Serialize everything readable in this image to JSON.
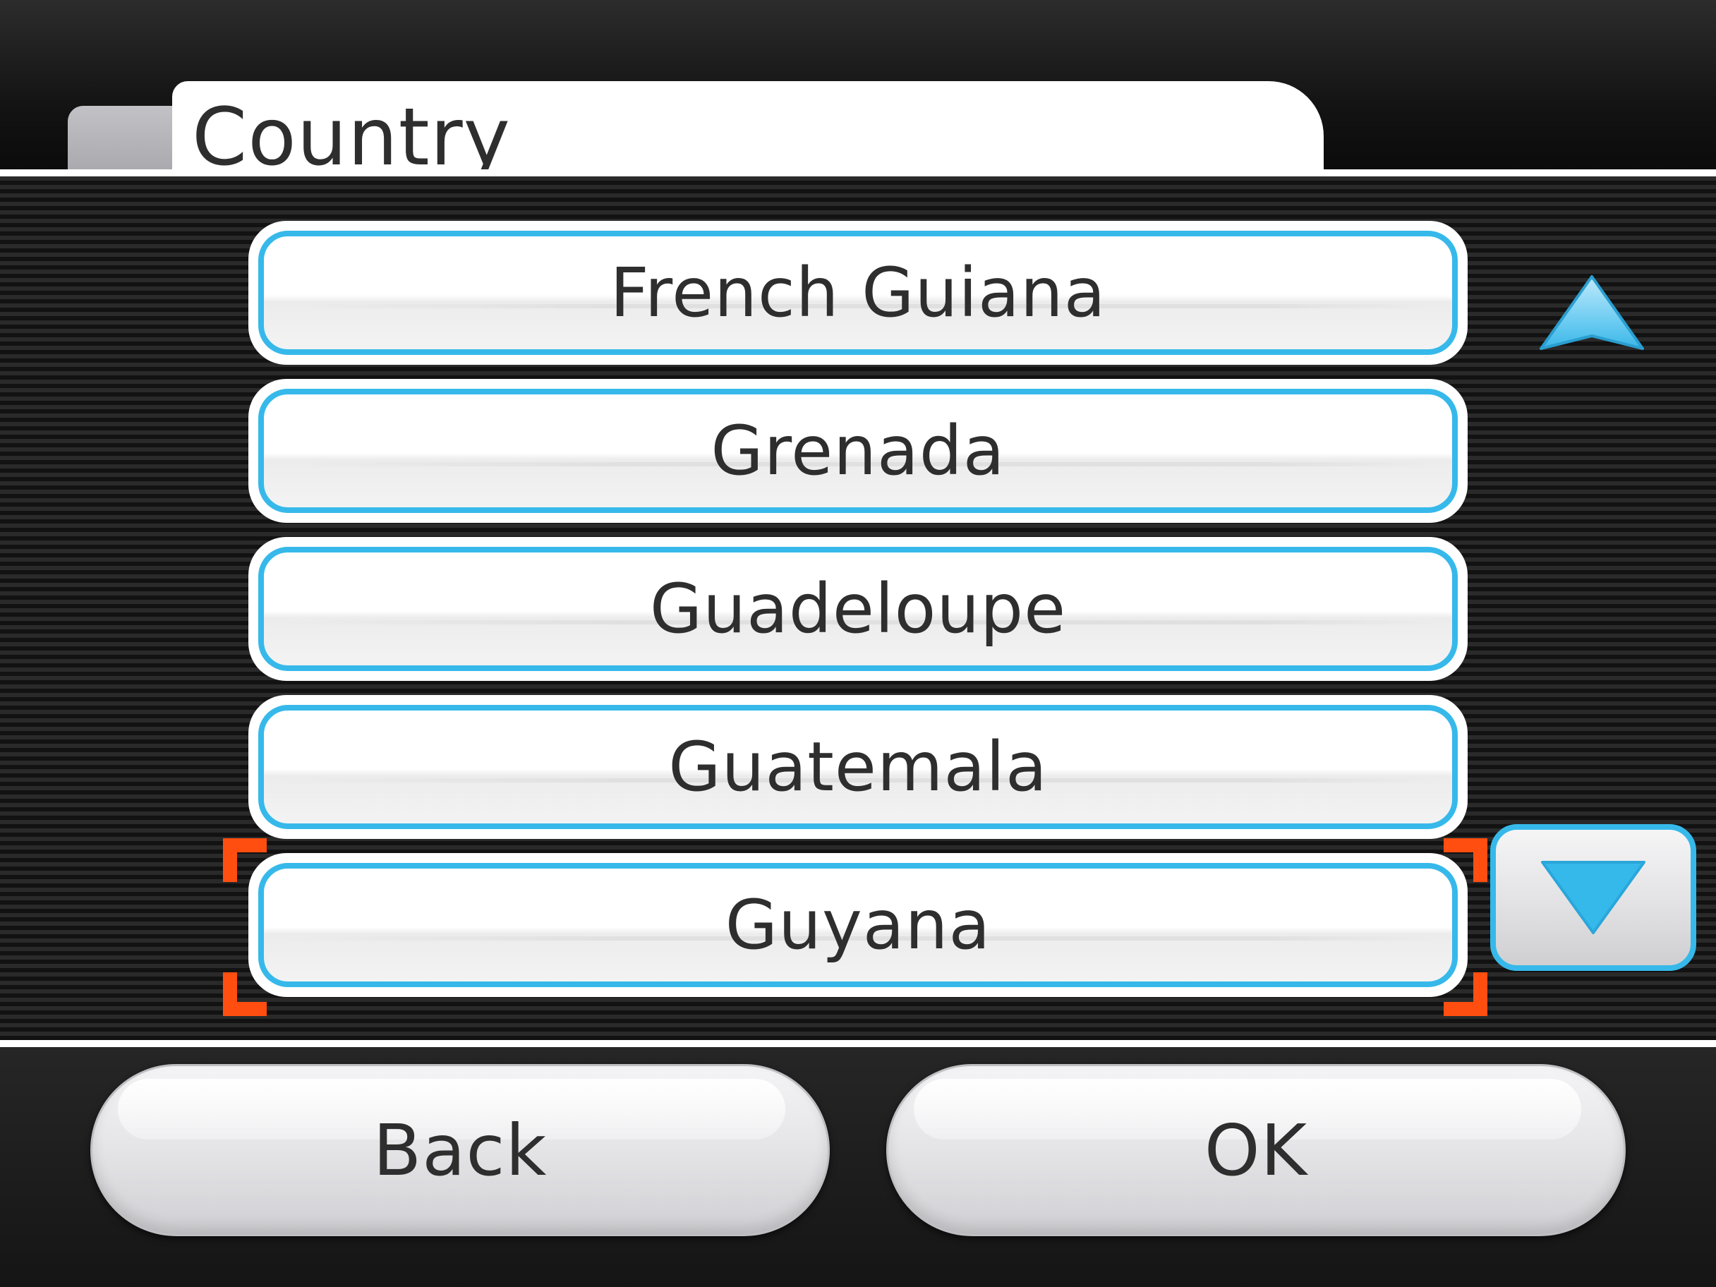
{
  "header": {
    "title": "Country"
  },
  "list": {
    "items": [
      {
        "label": "French Guiana",
        "selected": false
      },
      {
        "label": "Grenada",
        "selected": false
      },
      {
        "label": "Guadeloupe",
        "selected": false
      },
      {
        "label": "Guatemala",
        "selected": false
      },
      {
        "label": "Guyana",
        "selected": true
      }
    ]
  },
  "scroll": {
    "up_icon": "triangle-up-icon",
    "down_icon": "triangle-down-icon"
  },
  "footer": {
    "back_label": "Back",
    "ok_label": "OK"
  },
  "colors": {
    "accent": "#36b9ea",
    "selection": "#ff4e10",
    "text": "#2e2e2e"
  }
}
